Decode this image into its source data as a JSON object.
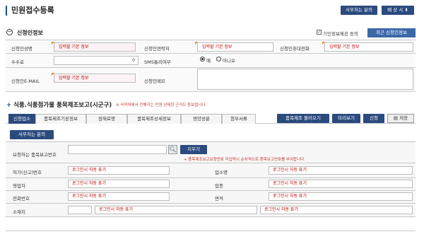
{
  "page": {
    "title": "민원접수등록"
  },
  "header_buttons": {
    "first": "사무처는 분의",
    "second": "배 상 시 ⬇"
  },
  "applicant": {
    "section_title": "신청인정보",
    "privacy_label": "기인정보제공 동의",
    "recent_button": "최근 신청인정보",
    "fields": {
      "name_label": "신청인성명",
      "name_value": "입력할 기본 정보",
      "phone_label": "신청인연락처",
      "phone_value": "입력할 기본 정보",
      "mobile_label": "신청인휴대전화",
      "mobile_value": "입력할 기본 정보",
      "fee_label": "수수료",
      "fee_value": "0",
      "sms_label": "SMS통리여부",
      "sms_yes": "예",
      "sms_no": "아니오",
      "email_label": "신청인E-MAIL",
      "email_value": "입력할 기본 정보",
      "memo_label": "신청인메모"
    }
  },
  "report": {
    "section_title": "식품.식품첨가물 품목제조보고(시군구)",
    "note": "※ 식약처에서 전해지는 민원 상태한 근거도 동보립니다.",
    "tabs": [
      "신청업소",
      "품목제조기본정보",
      "원재료명",
      "품목제조상세정보",
      "영양성분",
      "첨부서류"
    ],
    "action_buttons": [
      "품목제조 불러오기",
      "미리보기",
      "신청",
      "저장"
    ],
    "sub_button": "사무처는 분의",
    "search": {
      "label": "요청하는 품목보고번호",
      "button": "지우기",
      "hint": "+ 품목제조보고요청번호 미입력시 순차적으로 품목보고번호를 부여합니다."
    },
    "rows": {
      "license_label": "허가(신고)번호",
      "license_value": "로그인시 자동 표기",
      "business_name_label": "업소명",
      "business_name_value": "로그인시 자동 표기",
      "owner_label": "영업자",
      "owner_value": "로그인시 자동 표기",
      "type_label": "업종",
      "type_value": "로그인시 자동 표기",
      "tel_label": "전화번호",
      "tel_value": "로그인시 자동 표기",
      "area_label": "면적",
      "area_value": "로그인시 자동 표기",
      "address_label": "소재지",
      "address_value1": "로그인시 자동 표기",
      "address_value2": "로그인시 자동 표기"
    }
  },
  "colors": {
    "navy": "#2b4a7e",
    "blue": "#3b68a8",
    "red_text": "#c00000",
    "marker": "#e4862a"
  }
}
